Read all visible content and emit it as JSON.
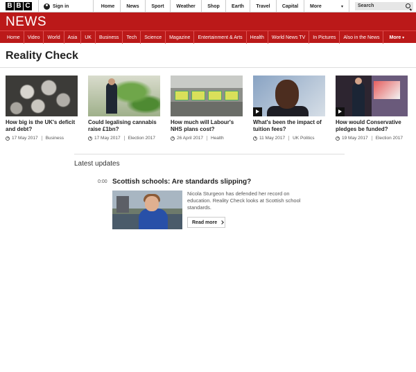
{
  "topbar": {
    "logo_letters": [
      "B",
      "B",
      "C"
    ],
    "signin_label": "Sign in",
    "nav": [
      {
        "label": "Home",
        "w": 36
      },
      {
        "label": "News",
        "w": 36
      },
      {
        "label": "Sport",
        "w": 36
      },
      {
        "label": "Weather",
        "w": 45
      },
      {
        "label": "Shop",
        "w": 35
      },
      {
        "label": "Earth",
        "w": 35
      },
      {
        "label": "Travel",
        "w": 38
      },
      {
        "label": "Capital",
        "w": 40
      }
    ],
    "more_label": "More",
    "search_placeholder": "Search"
  },
  "banner": {
    "title": "NEWS"
  },
  "news_nav": [
    "Home",
    "Video",
    "World",
    "Asia",
    "UK",
    "Business",
    "Tech",
    "Science",
    "Magazine",
    "Entertainment & Arts",
    "Health",
    "World News TV",
    "In Pictures",
    "Also in the News"
  ],
  "news_nav_more": "More",
  "page_title": "Reality Check",
  "stories": [
    {
      "title": "How big is the UK's deficit and debt?",
      "date": "17 May 2017",
      "section": "Business",
      "video": false
    },
    {
      "title": "Could legalising cannabis raise £1bn?",
      "date": "17 May 2017",
      "section": "Election 2017",
      "video": false
    },
    {
      "title": "How much will Labour's NHS plans cost?",
      "date": "26 April 2017",
      "section": "Health",
      "video": false
    },
    {
      "title": "What's been the impact of tuition fees?",
      "date": "11 May 2017",
      "section": "UK Politics",
      "video": true
    },
    {
      "title": "How would Conservative pledges be funded?",
      "date": "19 May 2017",
      "section": "Election 2017",
      "video": true
    }
  ],
  "updates": {
    "heading": "Latest updates",
    "time": "0:00",
    "title": "Scottish schools: Are standards slipping?",
    "summary": "Nicola Sturgeon has defended her record on education. Reality Check looks at Scottish school standards.",
    "read_more": "Read more"
  }
}
